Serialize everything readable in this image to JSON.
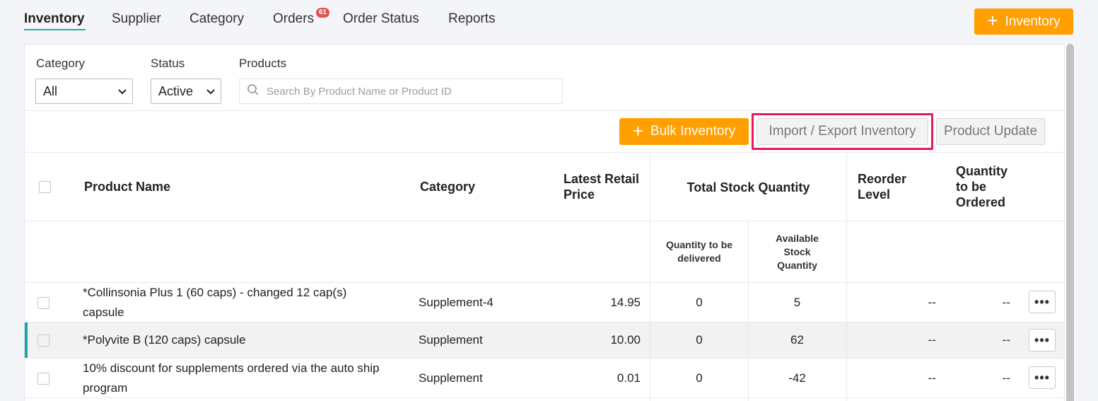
{
  "nav": {
    "tabs": [
      {
        "label": "Inventory"
      },
      {
        "label": "Supplier"
      },
      {
        "label": "Category"
      },
      {
        "label": "Orders"
      },
      {
        "label": "Order Status"
      },
      {
        "label": "Reports"
      }
    ],
    "orders_badge": "61",
    "add_button": "Inventory"
  },
  "filters": {
    "category_label": "Category",
    "category_value": "All",
    "status_label": "Status",
    "status_value": "Active",
    "products_label": "Products",
    "search_placeholder": "Search By Product Name or Product ID"
  },
  "toolbar": {
    "bulk_inventory": "Bulk Inventory",
    "import_export": "Import / Export Inventory",
    "product_update": "Product Update"
  },
  "table": {
    "headers": {
      "product_name": "Product Name",
      "category": "Category",
      "latest_retail_price_1": "Latest Retail",
      "latest_retail_price_2": "Price",
      "total_stock_quantity": "Total Stock Quantity",
      "reorder_level_1": "Reorder",
      "reorder_level_2": "Level",
      "qty_to_order_1": "Quantity",
      "qty_to_order_2": "to be",
      "qty_to_order_3": "Ordered",
      "qty_to_be_delivered_1": "Quantity to be",
      "qty_to_be_delivered_2": "delivered",
      "available_stock_1": "Available",
      "available_stock_2": "Stock",
      "available_stock_3": "Quantity"
    },
    "rows": [
      {
        "name_1": "*Collinsonia Plus 1 (60 caps) - changed 12 cap(s)",
        "name_2": "capsule",
        "category": "Supplement-4",
        "price": "14.95",
        "to_deliver": "0",
        "available": "5",
        "reorder": "--",
        "to_order": "--"
      },
      {
        "name_1": "*Polyvite B (120 caps) capsule",
        "name_2": "",
        "category": "Supplement",
        "price": "10.00",
        "to_deliver": "0",
        "available": "62",
        "reorder": "--",
        "to_order": "--"
      },
      {
        "name_1": "10% discount for supplements ordered via the auto ship",
        "name_2": "program",
        "category": "Supplement",
        "price": "0.01",
        "to_deliver": "0",
        "available": "-42",
        "reorder": "--",
        "to_order": "--"
      }
    ],
    "more_label": "•••"
  },
  "colors": {
    "accent_orange": "#ff9f00",
    "teal": "#2aa8a8",
    "highlight_pink": "#e8175d",
    "badge_red": "#e0524e"
  },
  "icons": {
    "plus": "plus-icon",
    "search": "search-icon",
    "chevron": "chevron-down-icon",
    "more": "more-horizontal-icon"
  }
}
